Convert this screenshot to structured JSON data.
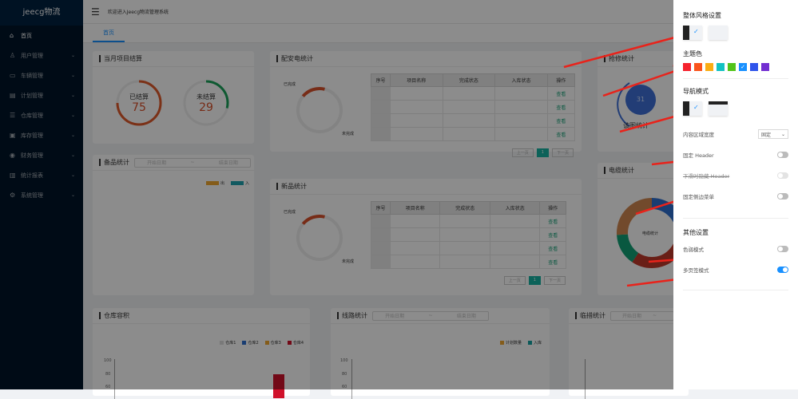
{
  "sidebar": {
    "logo": "jeecg物流",
    "items": [
      {
        "icon": "⌂",
        "label": "首页"
      },
      {
        "icon": "♙",
        "label": "用户管理"
      },
      {
        "icon": "▭",
        "label": "车辆管理"
      },
      {
        "icon": "▤",
        "label": "计划管理"
      },
      {
        "icon": "☰",
        "label": "仓库管理"
      },
      {
        "icon": "▣",
        "label": "库存管理"
      },
      {
        "icon": "◉",
        "label": "财务管理"
      },
      {
        "icon": "▥",
        "label": "统计报表"
      },
      {
        "icon": "⚙",
        "label": "系统管理"
      }
    ]
  },
  "header": {
    "welcome": "欢迎进入Jeecg物流管理系统"
  },
  "tabs": [
    {
      "label": "首页"
    }
  ],
  "settle": {
    "title": "当月项目结算",
    "done_label": "已结算",
    "done_value": "75",
    "undone_label": "未结算",
    "undone_value": "29"
  },
  "spare": {
    "title": "备品统计",
    "start": "开始日期",
    "sep": "~",
    "end": "结束日期",
    "legend": [
      "出",
      "入"
    ]
  },
  "power": {
    "title": "配安电统计",
    "done": "已完成",
    "undone": "未完成"
  },
  "newp": {
    "title": "新品统计",
    "done": "已完成",
    "undone": "未完成"
  },
  "table": {
    "headers": [
      "序号",
      "项目名称",
      "完成状态",
      "入库状态",
      "操作"
    ],
    "op": "查看",
    "prev": "上一页",
    "page": "1",
    "next": "下一页"
  },
  "repair": {
    "title": "抢修统计",
    "value": "31",
    "label": "该图统计"
  },
  "cable": {
    "title": "电缆统计",
    "center": "电缆统计"
  },
  "warehouse": {
    "title": "仓库容积",
    "legend": [
      "仓库1",
      "仓库2",
      "仓库3",
      "仓库4"
    ],
    "yticks": [
      "100",
      "80",
      "60"
    ]
  },
  "line": {
    "title": "线路统计",
    "start": "开始日期",
    "sep": "~",
    "end": "结束日期",
    "legend": [
      "计划数量",
      "入库"
    ],
    "yticks": [
      "100",
      "80",
      "60"
    ]
  },
  "temp": {
    "title": "临措统计",
    "start": "开始日期",
    "sep": "~"
  },
  "drawer": {
    "style_title": "整体风格设置",
    "theme_title": "主题色",
    "theme_colors": [
      "#f5222d",
      "#fa541c",
      "#faad14",
      "#13c2c2",
      "#52c41a",
      "#1890ff",
      "#2f54eb",
      "#722ed1"
    ],
    "nav_title": "导航模式",
    "content_width": "内容区域宽度",
    "content_width_value": "固定",
    "fixed_header": "固定 Header",
    "hide_header": "下滑时隐藏 Header",
    "fixed_sidebar": "固定侧边菜单",
    "other_title": "其他设置",
    "weak_mode": "色弱模式",
    "multi_tab": "多页签模式"
  }
}
